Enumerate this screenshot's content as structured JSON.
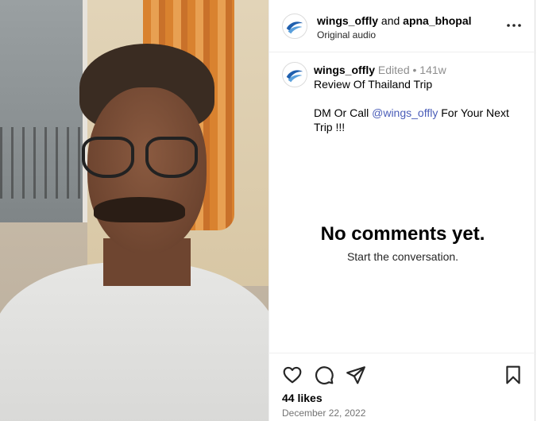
{
  "header": {
    "user1": "wings_offly",
    "joiner": " and ",
    "user2": "apna_bhopal",
    "subtitle": "Original audio",
    "more_icon": "more-horizontal-icon"
  },
  "caption": {
    "username": "wings_offly",
    "edited": " Edited",
    "dot": " • ",
    "age": "141w",
    "text_line1": "Review Of Thailand Trip",
    "text_pre": "DM Or Call ",
    "mention": "@wings_offly",
    "text_post": " For Your Next Trip !!!"
  },
  "comments": {
    "empty_title": "No comments yet.",
    "empty_subtitle": "Start the conversation."
  },
  "actions": {
    "like_icon": "heart-icon",
    "comment_icon": "comment-icon",
    "share_icon": "send-icon",
    "save_icon": "bookmark-icon",
    "likes": "44 likes",
    "date": "December 22, 2022"
  },
  "colors": {
    "mention": "#4a5db8",
    "meta_gray": "#8e8e8e",
    "divider": "#efefef"
  }
}
